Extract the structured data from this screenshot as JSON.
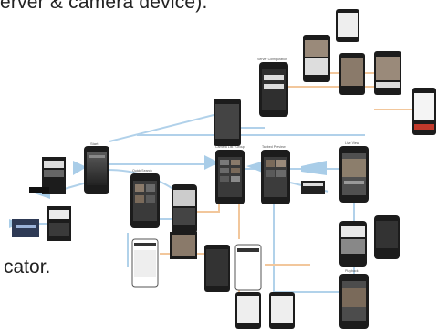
{
  "text": {
    "top_fragment": "erver & camera device).",
    "side_fragment": "cator."
  },
  "screens": [
    {
      "id": "start",
      "label": "Start",
      "dark": true
    },
    {
      "id": "login-a",
      "label": "",
      "dark": false
    },
    {
      "id": "login-b",
      "label": "",
      "dark": false
    },
    {
      "id": "server-config",
      "label": "Server Configuration",
      "dark": true
    },
    {
      "id": "camera-list",
      "label": "Camera List / Group",
      "dark": true
    },
    {
      "id": "tabbed-preview",
      "label": "Tabbed Preview",
      "dark": true
    },
    {
      "id": "live-view",
      "label": "Live View",
      "dark": true
    },
    {
      "id": "quick-search",
      "label": "Quick Search",
      "dark": true
    },
    {
      "id": "playback",
      "label": "Playback",
      "dark": true
    }
  ],
  "colors": {
    "flow_blue": "#a9cde8",
    "flow_orange": "#f2c79c",
    "phone_body": "#1c1c1c",
    "screen_bg": "#2b2b2b"
  }
}
